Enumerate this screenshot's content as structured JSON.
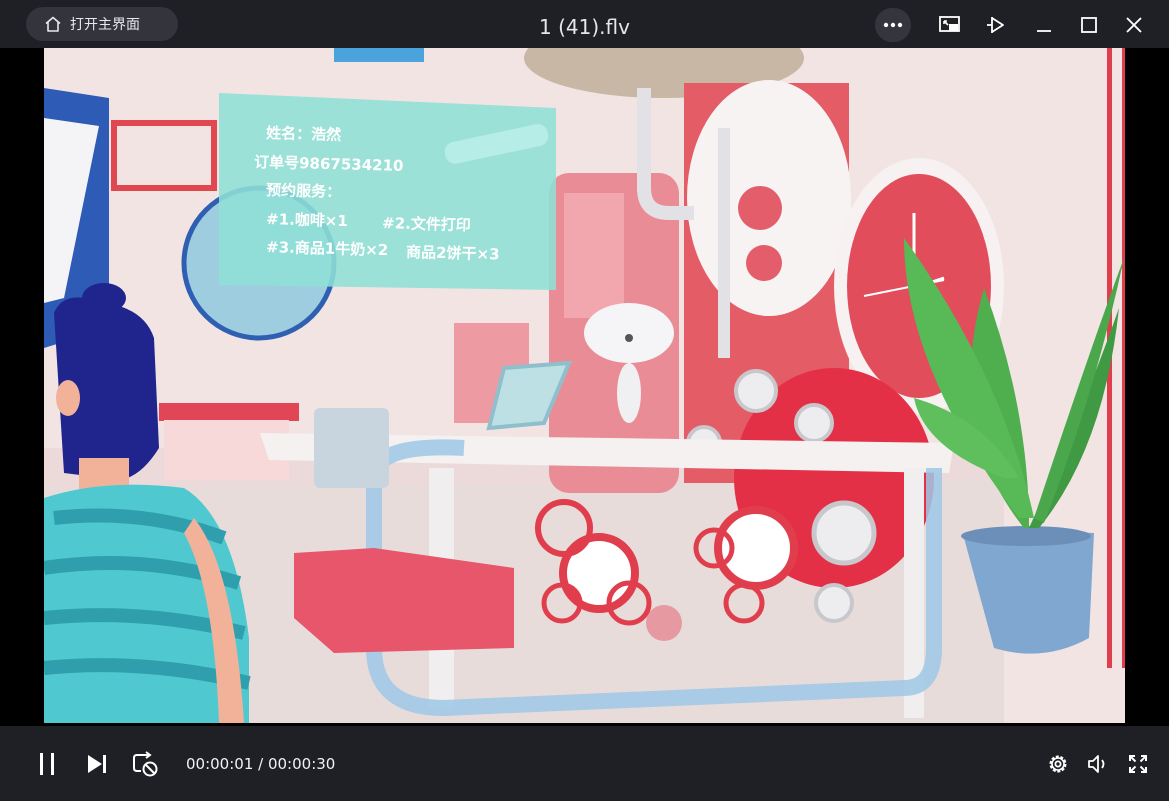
{
  "titlebar": {
    "home_label": "打开主界面",
    "title": "1 (41).flv"
  },
  "video": {
    "panel": {
      "line1": "姓名：浩然",
      "line2": "订单号9867534210",
      "line3": "预约服务：",
      "line4a": "#1.咖啡×1",
      "line4b": "#2.文件打印",
      "line5a": "#3.商品1牛奶×2",
      "line5b": "商品2饼干×3"
    }
  },
  "controls": {
    "current_time": "00:00:01",
    "separator": " / ",
    "duration": "00:00:30"
  },
  "colors": {
    "bar_bg": "#1f2026",
    "accent_red": "#e0474f",
    "panel_teal": "#8fe0d6"
  }
}
